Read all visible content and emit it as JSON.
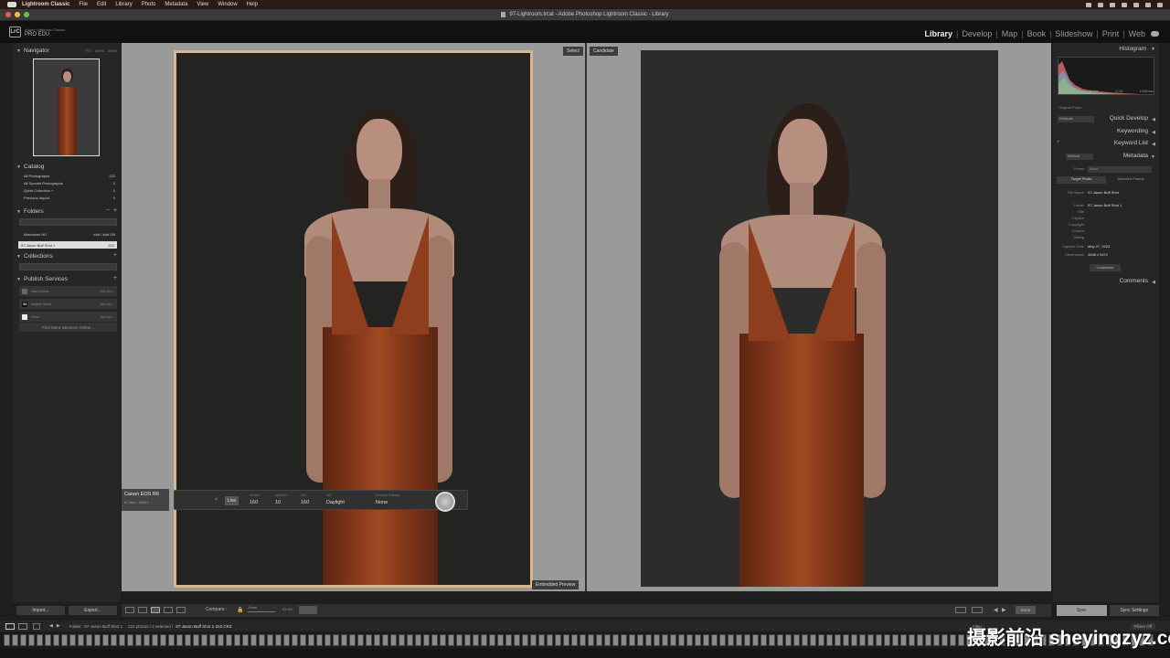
{
  "menubar": {
    "app": "Lightroom Classic",
    "items": [
      "File",
      "Edit",
      "Library",
      "Photo",
      "Metadata",
      "View",
      "Window",
      "Help"
    ]
  },
  "window": {
    "title": "97-Lightroom.lrcat - Adobe Photoshop Lightroom Classic - Library"
  },
  "identity": {
    "badge": "LrC",
    "line1": "Adobe Lightroom Classic",
    "line2": "PRO EDU"
  },
  "modules": [
    "Library",
    "Develop",
    "Map",
    "Book",
    "Slideshow",
    "Print",
    "Web"
  ],
  "left_panel": {
    "navigator": {
      "title": "Navigator",
      "options": [
        "FIT",
        "100%",
        "300%"
      ]
    },
    "catalog": {
      "title": "Catalog",
      "rows": [
        {
          "label": "All Photographs",
          "count": "222"
        },
        {
          "label": "All Synced Photographs",
          "count": "0"
        },
        {
          "label": "Quick Collection +",
          "count": "0"
        },
        {
          "label": "Previous Import",
          "count": "0"
        }
      ]
    },
    "folders": {
      "title": "Folders",
      "volume": {
        "label": "Macintosh HD",
        "info": "### / ### GB"
      },
      "selected": {
        "label": "97-Jason Buff Shot 1",
        "count": "222"
      }
    },
    "collections": {
      "title": "Collections"
    },
    "publish": {
      "title": "Publish Services",
      "rows": [
        {
          "label": "Hard Drive",
          "action": "Set Up..."
        },
        {
          "label": "Adobe Stock",
          "badge": "St",
          "action": "Set Up..."
        },
        {
          "label": "Flickr",
          "action": "Set Up..."
        }
      ],
      "find_more": "Find More Services Online..."
    },
    "import_label": "Import...",
    "export_label": "Export..."
  },
  "compare": {
    "select_label": "Select",
    "candidate_label": "Candidate",
    "embedded_preview": "Embedded Preview"
  },
  "camera": {
    "model": "Canon EOS R6",
    "file": "97-Jaso... Shot 1",
    "live": "Live",
    "close": "×",
    "controls": [
      {
        "head": "Shutter",
        "value": "160"
      },
      {
        "head": "Aperture",
        "value": "10"
      },
      {
        "head": "ISO",
        "value": "160"
      },
      {
        "head": "WB",
        "value": "Daylight"
      },
      {
        "head": "Develop Settings",
        "value": "None"
      }
    ]
  },
  "toolbar": {
    "compare_label": "Compare :",
    "zoom_label": "Zoom",
    "zoom_value": "93.3%",
    "done_label": "Done"
  },
  "filmbar": {
    "folder": "Folder : 97-Jason Buff Shot 1",
    "count": "222 photos / 2 selected /",
    "file": "97-Jason Buff Shot 1-222.CR3",
    "filter_label": "Filter :",
    "filter_value": "Filters Off"
  },
  "right_panel": {
    "histogram": {
      "title": "Histogram",
      "info": [
        "ISO 160",
        "50 mm",
        "f / 10",
        "1/160 sec"
      ],
      "original": "Original Photo"
    },
    "quick_develop": {
      "title": "Quick Develop",
      "preset": "Defaults"
    },
    "keywording": {
      "title": "Keywording"
    },
    "keyword_list": {
      "title": "Keyword List"
    },
    "metadata": {
      "title": "Metadata",
      "preset": "Default",
      "preset_label": "Preset",
      "preset_value": "None",
      "tabs": [
        "Target Photo",
        "Selected Photos"
      ],
      "fields": [
        {
          "key": "File Name",
          "value": "97-Jason Buff Shot"
        },
        {
          "key": "Folder",
          "value": "97-Jason Buff Shot 1"
        },
        {
          "key": "Title",
          "value": ""
        },
        {
          "key": "Caption",
          "value": ""
        },
        {
          "key": "Copyright",
          "value": ""
        },
        {
          "key": "Creator",
          "value": ""
        },
        {
          "key": "Rating",
          "value": ""
        },
        {
          "key": "Capture Date",
          "value": "May 27, 2023"
        },
        {
          "key": "Dimensions",
          "value": "3648 x 5472"
        }
      ],
      "customize": "Customize"
    },
    "comments": {
      "title": "Comments"
    },
    "sync_label": "Sync",
    "sync_settings_label": "Sync Settings"
  },
  "watermark": "摄影前沿 sheyingzyz.com"
}
